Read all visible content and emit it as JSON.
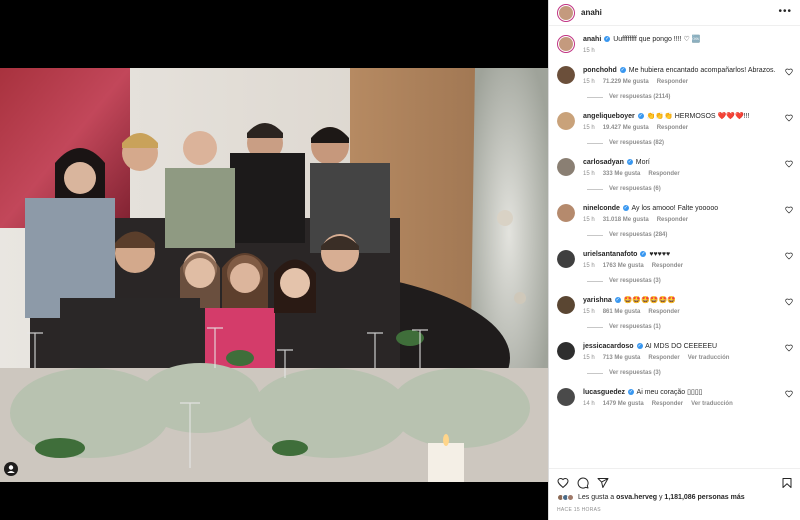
{
  "post": {
    "username": "anahi",
    "caption_text": "Uuffffffff que pongo !!!! ♡ 🆒",
    "caption_time": "15 h",
    "likes_prefix": "Les gusta a",
    "likes_user": "osva.herveg",
    "likes_middle": "y",
    "likes_count": "1,181,086",
    "likes_suffix": "personas más",
    "time_ago": "HACE 15 HORAS"
  },
  "comments": [
    {
      "user": "ponchohd",
      "text": "Me hubiera encantado acompañarlos! Abrazos.",
      "time": "15 h",
      "likes": "71.229 Me gusta",
      "reply": "Responder",
      "translate": "",
      "replies": "Ver respuestas (2114)",
      "avatar_color": "#6b4f3a"
    },
    {
      "user": "angeliqueboyer",
      "text": "👏👏👏 HERMOSOS ❤️❤️❤️!!!",
      "time": "15 h",
      "likes": "19.427 Me gusta",
      "reply": "Responder",
      "translate": "",
      "replies": "Ver respuestas (82)",
      "avatar_color": "#c9a27a"
    },
    {
      "user": "carlosadyan",
      "text": "Morí",
      "time": "15 h",
      "likes": "333 Me gusta",
      "reply": "Responder",
      "translate": "",
      "replies": "Ver respuestas (6)",
      "avatar_color": "#8a7f73"
    },
    {
      "user": "ninelconde",
      "text": "Ay los amooo! Falte yooooo",
      "time": "15 h",
      "likes": "31.018 Me gusta",
      "reply": "Responder",
      "translate": "",
      "replies": "Ver respuestas (284)",
      "avatar_color": "#b58a6d"
    },
    {
      "user": "urielsantanafoto",
      "text": "♥♥♥♥♥",
      "time": "15 h",
      "likes": "1763 Me gusta",
      "reply": "Responder",
      "translate": "",
      "replies": "Ver respuestas (3)",
      "avatar_color": "#3f3f3f"
    },
    {
      "user": "yarishna",
      "text": "🤩🤩🤩🤩🤩🤩",
      "time": "15 h",
      "likes": "861 Me gusta",
      "reply": "Responder",
      "translate": "",
      "replies": "Ver respuestas (1)",
      "avatar_color": "#5a4632"
    },
    {
      "user": "jessicacardoso",
      "text": "AI MDS DO CEEEEEU",
      "time": "15 h",
      "likes": "713 Me gusta",
      "reply": "Responder",
      "translate": "Ver traducción",
      "replies": "Ver respuestas (3)",
      "avatar_color": "#2e2e2e"
    },
    {
      "user": "lucasguedez",
      "text": "Ai meu coração ▯▯▯▯",
      "time": "14 h",
      "likes": "1479 Me gusta",
      "reply": "Responder",
      "translate": "Ver traducción",
      "replies": "",
      "avatar_color": "#4a4a4a"
    }
  ],
  "icons": {
    "like": "heart-icon",
    "comment": "comment-icon",
    "share": "share-icon",
    "save": "bookmark-icon",
    "more": "more-options-icon",
    "tag": "user-tag-icon"
  },
  "colors": {
    "verified": "#3897f0",
    "text": "#262626",
    "muted": "#8e8e8e",
    "story_ring": "#c13584"
  }
}
